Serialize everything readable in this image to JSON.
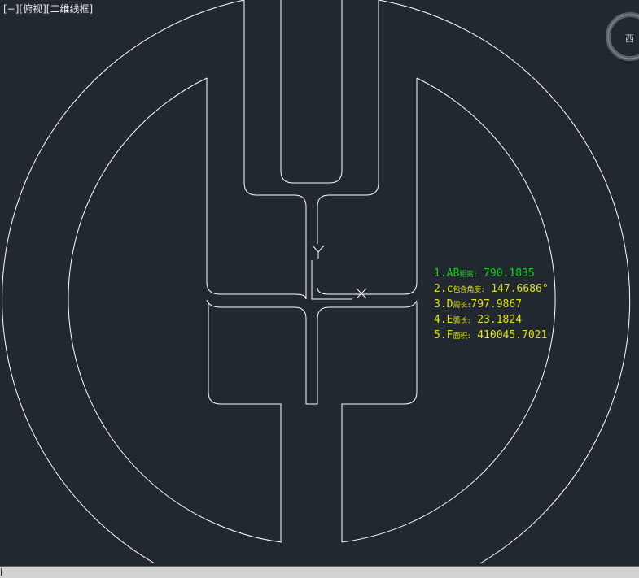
{
  "viewport": {
    "label": "[−][俯视][二维线框]",
    "background": "#212830",
    "line_color": "#ffffff"
  },
  "viewcube": {
    "direction_label": "西"
  },
  "annotations": [
    {
      "index": "1.",
      "key": "AB",
      "key_small": "距离:",
      "value": " 790.1835",
      "color": "#19d219"
    },
    {
      "index": "2.",
      "key": "c",
      "key_small": "包含角度:",
      "value": " 147.6686°",
      "color": "#e1e11e"
    },
    {
      "index": "3.",
      "key": "D",
      "key_small": "周长:",
      "value": "797.9867",
      "color": "#e1e11e"
    },
    {
      "index": "4.",
      "key": "E",
      "key_small": "弧长:",
      "value": " 23.1824",
      "color": "#e1e11e"
    },
    {
      "index": "5.",
      "key": "F",
      "key_small": "面积:",
      "value": " 410045.7021",
      "color": "#e1e11e"
    }
  ],
  "statusbar": {
    "background": "#d3d3d3"
  }
}
